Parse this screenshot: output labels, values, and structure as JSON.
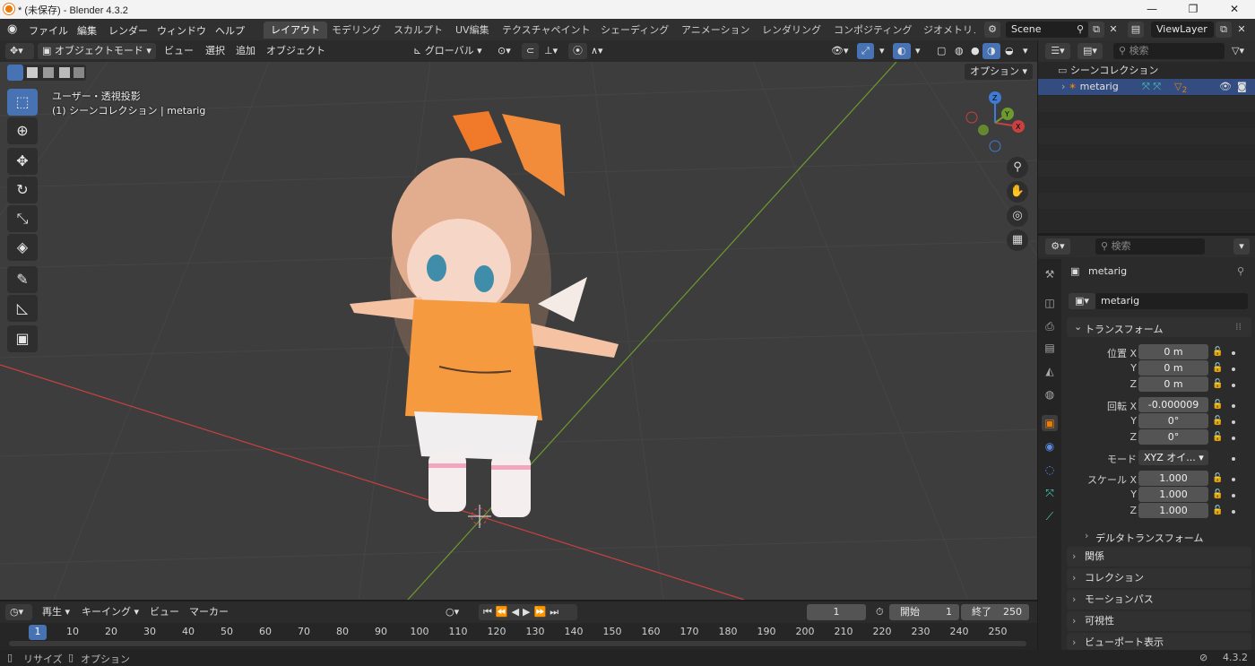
{
  "window": {
    "title": "* (未保存) - Blender 4.3.2",
    "minimize": "—",
    "maximize": "❐",
    "close": "✕"
  },
  "menubar": {
    "items": [
      "ファイル",
      "編集",
      "レンダー",
      "ウィンドウ",
      "ヘルプ"
    ],
    "workspaces": [
      "レイアウト",
      "モデリング",
      "スカルプト",
      "UV編集",
      "テクスチャペイント",
      "シェーディング",
      "アニメーション",
      "レンダリング",
      "コンポジティング",
      "ジオメトリノ"
    ],
    "active_workspace": "レイアウト",
    "scene": "Scene",
    "view_layer": "ViewLayer"
  },
  "viewport_header": {
    "mode": "オブジェクトモード",
    "menus": [
      "ビュー",
      "選択",
      "追加",
      "オブジェクト"
    ],
    "orientation": "グローバル",
    "options": "オプション"
  },
  "viewport": {
    "view_name": "ユーザー・透視投影",
    "collection_info": "(1) シーンコレクション | metarig",
    "gizmo_axes": [
      "X",
      "Y",
      "Z"
    ]
  },
  "outliner": {
    "search_placeholder": "検索",
    "scene_collection": "シーンコレクション",
    "object": "metarig",
    "badge_count": "2"
  },
  "properties": {
    "search_placeholder": "検索",
    "object_name": "metarig",
    "data_name": "metarig",
    "transform_title": "トランスフォーム",
    "location_label": "位置 X",
    "rotation_label": "回転 X",
    "scale_label": "スケール X",
    "y_label": "Y",
    "z_label": "Z",
    "location": [
      "0 m",
      "0 m",
      "0 m"
    ],
    "rotation": [
      "-0.000009",
      "0°",
      "0°"
    ],
    "mode_label": "モード",
    "mode_value": "XYZ オイ...",
    "scale": [
      "1.000",
      "1.000",
      "1.000"
    ],
    "delta_transform": "デルタトランスフォーム",
    "panels": [
      "関係",
      "コレクション",
      "モーションパス",
      "可視性",
      "ビューポート表示"
    ]
  },
  "timeline": {
    "menus": [
      "再生",
      "キーイング",
      "ビュー",
      "マーカー"
    ],
    "current_frame": "1",
    "start_label": "開始",
    "start_value": "1",
    "end_label": "終了",
    "end_value": "250",
    "ticks": [
      "1",
      "10",
      "20",
      "30",
      "40",
      "50",
      "60",
      "70",
      "80",
      "90",
      "100",
      "110",
      "120",
      "130",
      "140",
      "150",
      "160",
      "170",
      "180",
      "190",
      "200",
      "210",
      "220",
      "230",
      "240",
      "250"
    ]
  },
  "statusbar": {
    "left_1": "リサイズ",
    "left_2": "オプション",
    "version": "4.3.2"
  },
  "colors": {
    "accent": "#4772b3",
    "orange": "#e87d0d",
    "x_axis": "#c84141",
    "y_axis": "#6e9a2d"
  }
}
